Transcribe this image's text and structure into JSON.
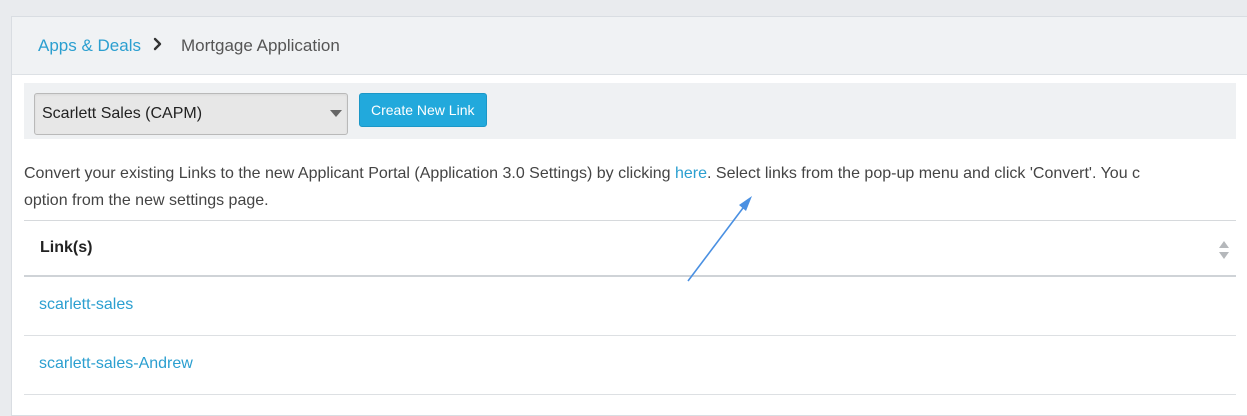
{
  "breadcrumb": {
    "parent": "Apps & Deals",
    "current": "Mortgage Application",
    "separator_icon": "chevron-right-icon"
  },
  "toolbar": {
    "select_value": "Scarlett Sales (CAPM)",
    "create_button_label": "Create New Link"
  },
  "info": {
    "text_before_link": "Convert your existing Links to the new Applicant Portal (Application 3.0 Settings) by clicking ",
    "link_label": "here",
    "text_after_link": ". Select links from the pop-up menu and click 'Convert'. You c",
    "line2": "option from the new settings page."
  },
  "table": {
    "column_header": "Link(s)",
    "rows": [
      "scarlett-sales",
      "scarlett-sales-Andrew"
    ]
  },
  "colors": {
    "accent": "#22a9dc",
    "link": "#2b9fd0",
    "annotation_arrow": "#4a90e2"
  }
}
